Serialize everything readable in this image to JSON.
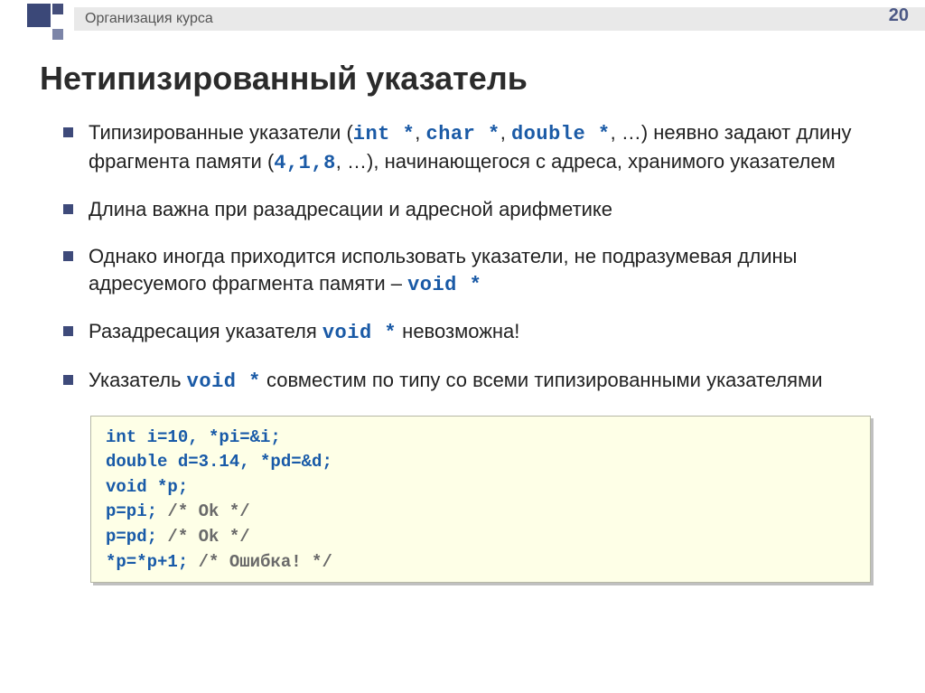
{
  "header": {
    "breadcrumb": "Организация курса",
    "page_number": "20"
  },
  "title": "Нетипизированный указатель",
  "bullets": {
    "b1_a": "Типизированные указатели (",
    "b1_code1": "int *",
    "b1_sep1": ", ",
    "b1_code2": "char *",
    "b1_sep2": ", ",
    "b1_code3": "double *",
    "b1_b": ", …) неявно задают длину фрагмента памяти (",
    "b1_code4": "4,1,8",
    "b1_c": ", …), начинающегося с адреса, хранимого указателем",
    "b2": "Длина важна при разадресации и адресной арифметике",
    "b3_a": "Однако иногда приходится использовать указатели, не подразумевая длины адресуемого фрагмента памяти – ",
    "b3_code": "void *",
    "b4_a": "Разадресация указателя ",
    "b4_code": "void *",
    "b4_b": " невозможна!",
    "b5_a": "Указатель ",
    "b5_code": "void *",
    "b5_b": " совместим по типу со всеми типизированными указателями"
  },
  "code": {
    "l1": "int i=10, *pi=&i;",
    "l2": "double d=3.14, *pd=&d;",
    "l3": "void *p;",
    "l4a": "p=pi; ",
    "l4c": "/* Ok */",
    "l5a": "p=pd; ",
    "l5c": "/* Ok */",
    "l6a": "*p=*p+1; ",
    "l6c": "/* Ошибка! */"
  }
}
